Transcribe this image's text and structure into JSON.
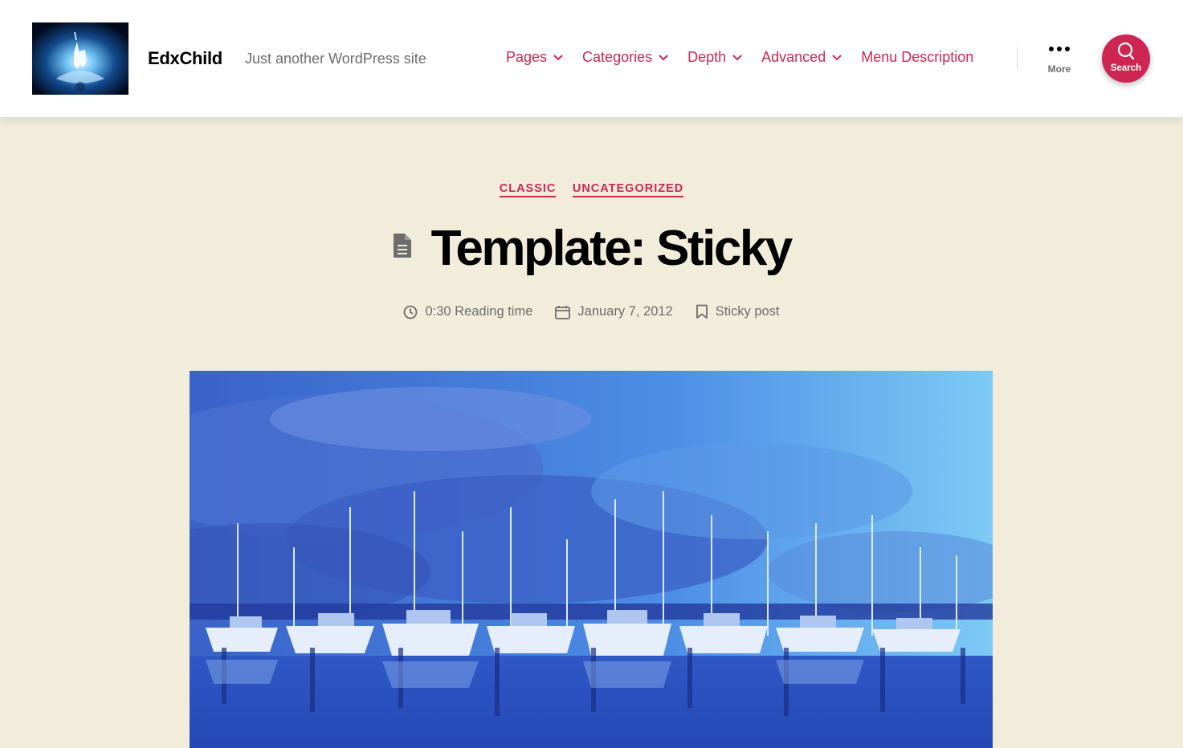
{
  "header": {
    "site_title": "EdxChild",
    "site_description": "Just another WordPress site",
    "nav": [
      {
        "label": "Pages",
        "has_submenu": true
      },
      {
        "label": "Categories",
        "has_submenu": true
      },
      {
        "label": "Depth",
        "has_submenu": true
      },
      {
        "label": "Advanced",
        "has_submenu": true
      },
      {
        "label": "Menu Description",
        "has_submenu": false
      }
    ],
    "more_label": "More",
    "search_label": "Search"
  },
  "post": {
    "categories": [
      "CLASSIC",
      "UNCATEGORIZED"
    ],
    "title": "Template: Sticky",
    "reading_time": "0:30 Reading time",
    "date": "January 7, 2012",
    "sticky": "Sticky post"
  },
  "colors": {
    "accent": "#cd2653",
    "background": "#f2ecdb",
    "header_bg": "#ffffff",
    "secondary_text": "#6d6d6d"
  },
  "icons": [
    "site-logo-unicorn",
    "chevron-down-icon",
    "more-dots-icon",
    "search-icon",
    "document-icon",
    "clock-icon",
    "calendar-icon",
    "bookmark-icon"
  ]
}
